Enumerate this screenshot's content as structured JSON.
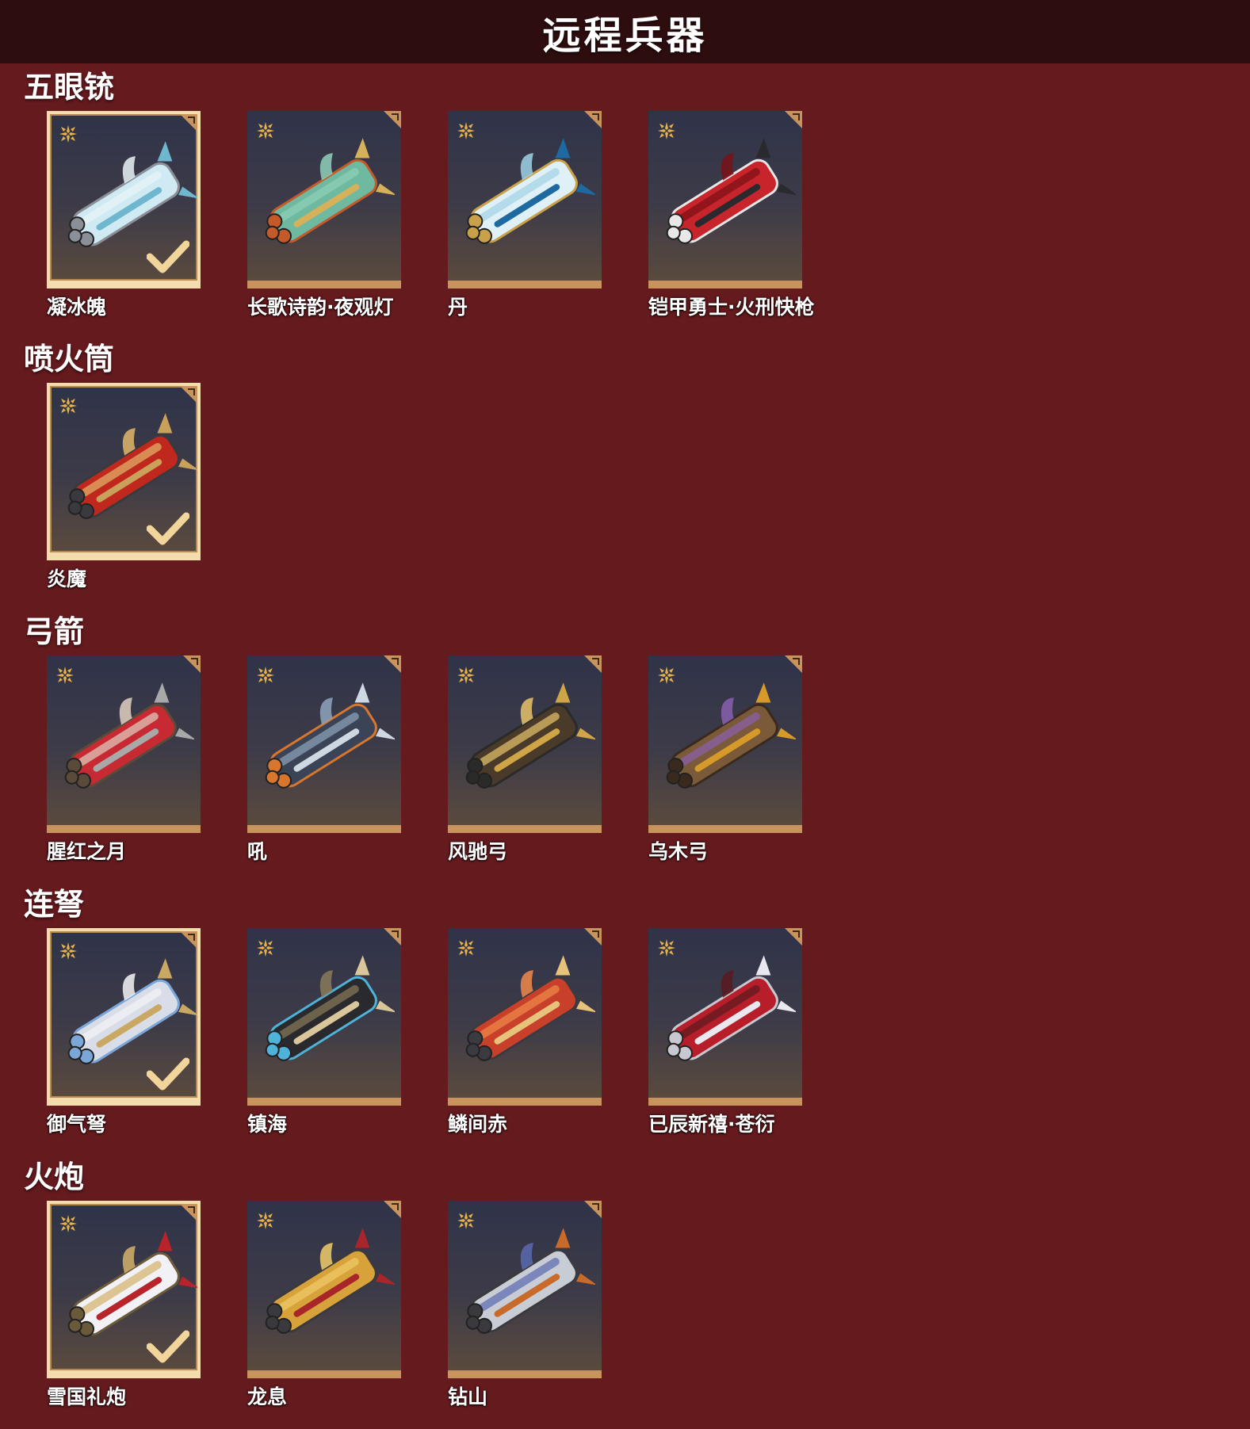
{
  "page": {
    "title": "远程兵器"
  },
  "colors": {
    "background": "#651a1e",
    "title_bar": "#2e0d0f",
    "card_frame": "#c8935d",
    "selected_frame": "#f3ddae"
  },
  "sections": [
    {
      "title": "五眼铳",
      "items": [
        {
          "name": "凝冰魄",
          "selected": true,
          "icon": "ice-gun-icon"
        },
        {
          "name": "长歌诗韵·夜观灯",
          "selected": false,
          "icon": "lantern-gun-icon"
        },
        {
          "name": "丹",
          "selected": false,
          "icon": "crane-gun-icon"
        },
        {
          "name": "铠甲勇士·火刑快枪",
          "selected": false,
          "icon": "red-armor-gun-icon"
        }
      ]
    },
    {
      "title": "喷火筒",
      "items": [
        {
          "name": "炎魔",
          "selected": true,
          "icon": "flame-tube-icon"
        }
      ]
    },
    {
      "title": "弓箭",
      "items": [
        {
          "name": "腥红之月",
          "selected": false,
          "icon": "crimson-bow-icon"
        },
        {
          "name": "吼",
          "selected": false,
          "icon": "roar-bow-icon"
        },
        {
          "name": "风驰弓",
          "selected": false,
          "icon": "wind-bow-icon"
        },
        {
          "name": "乌木弓",
          "selected": false,
          "icon": "ebony-bow-icon"
        }
      ]
    },
    {
      "title": "连弩",
      "items": [
        {
          "name": "御气弩",
          "selected": true,
          "icon": "silver-crossbow-icon"
        },
        {
          "name": "镇海",
          "selected": false,
          "icon": "sea-crossbow-icon"
        },
        {
          "name": "鳞间赤",
          "selected": false,
          "icon": "koi-crossbow-icon"
        },
        {
          "name": "已辰新禧·苍衍",
          "selected": false,
          "icon": "dragon-crossbow-icon"
        }
      ]
    },
    {
      "title": "火炮",
      "items": [
        {
          "name": "雪国礼炮",
          "selected": true,
          "icon": "snow-cannon-icon"
        },
        {
          "name": "龙息",
          "selected": false,
          "icon": "dragon-cannon-icon"
        },
        {
          "name": "钻山",
          "selected": false,
          "icon": "drill-cannon-icon"
        }
      ]
    }
  ]
}
